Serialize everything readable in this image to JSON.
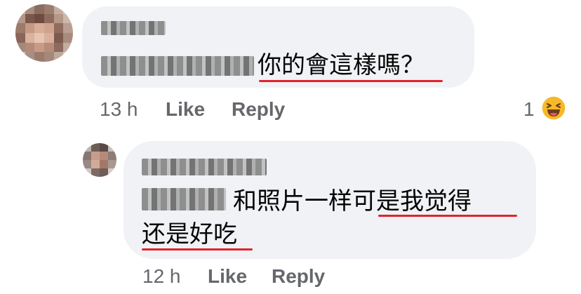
{
  "comments": [
    {
      "text": "你的會這樣嗎？",
      "time": "13 h",
      "like_label": "Like",
      "reply_label": "Reply",
      "reaction_count": "1",
      "reaction_icon": "haha-emoji-icon"
    },
    {
      "text_line1": "和照片一样可是我觉得",
      "text_line2": "还是好吃",
      "time": "12 h",
      "like_label": "Like",
      "reply_label": "Reply"
    }
  ],
  "colors": {
    "bubble": "#f0f2f5",
    "meta_text": "#65676b",
    "underline": "#e0242b",
    "haha_yellow": "#f7b928"
  }
}
